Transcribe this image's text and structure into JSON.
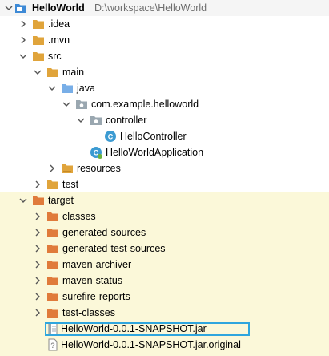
{
  "colors": {
    "folder": "#e0a43b",
    "folder_blue": "#3e8ad6",
    "source_folder": "#78aee7",
    "excluded_bg": "#fbf8d9",
    "class_icon": "#3c9bd2",
    "selection_border": "#2fa6de"
  },
  "tree": {
    "project_name": "HelloWorld",
    "project_path": "D:\\workspace\\HelloWorld",
    "idea": ".idea",
    "mvn": ".mvn",
    "src": "src",
    "main": "main",
    "java": "java",
    "package": "com.example.helloworld",
    "controller": "controller",
    "hello_controller": "HelloController",
    "hello_world_application": "HelloWorldApplication",
    "resources": "resources",
    "test": "test",
    "target": "target",
    "classes": "classes",
    "generated_sources": "generated-sources",
    "generated_test_sources": "generated-test-sources",
    "maven_archiver": "maven-archiver",
    "maven_status": "maven-status",
    "surefire_reports": "surefire-reports",
    "test_classes": "test-classes",
    "jar": "HelloWorld-0.0.1-SNAPSHOT.jar",
    "jar_original": "HelloWorld-0.0.1-SNAPSHOT.jar.original"
  }
}
